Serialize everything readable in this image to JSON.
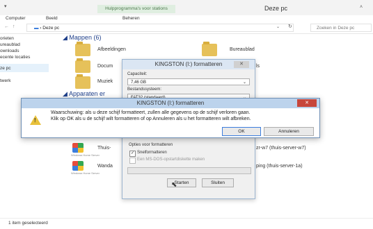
{
  "ribbon": {
    "qat": "▾",
    "tools_tab": "Hulpprogramma's voor stations",
    "window_title": "Deze pc",
    "tabs": [
      "Computer",
      "Beeld",
      "Beheren"
    ]
  },
  "address": {
    "path": "Deze pc",
    "search_placeholder": "Zoeken in Deze pc"
  },
  "nav": {
    "items": [
      "orieten",
      "ureaublad",
      "ownloads",
      "ecente locaties",
      "ze pc",
      "twerk"
    ]
  },
  "content": {
    "group_folders": "Mappen (6)",
    "folders": [
      "Afbeeldingen",
      "Bureaublad",
      "Docum",
      "Muziek"
    ],
    "group_devices": "Apparaten er",
    "network_items": [
      "Thuis-",
      "Wanda"
    ],
    "right_items": [
      "zr-w7 (thuis-server-w7)",
      "ping (thuis-server-1a)"
    ],
    "right_partial": "ls",
    "logo_sub": "Windows Home Server"
  },
  "format_dialog": {
    "title": "KINGSTON (I:) formatteren",
    "capacity_label": "Capaciteit:",
    "capacity_value": "7,46 GB",
    "fs_label": "Bestandssysteem:",
    "fs_value": "FAT32 (standaard)",
    "options_label": "Opties voor formatteren",
    "quick_format": "Snelformatteren",
    "msdos_disk": "Een MS-DOS-opstartdiskette maken",
    "start_button": "Starten",
    "close_button": "Sluiten"
  },
  "warning_dialog": {
    "title": "KINGSTON (I:) formatteren",
    "line1": "Waarschuwing: als u deze schijf formatteert, zullen alle gegevens op de schijf verloren gaan.",
    "line2": "Klik op OK als u de schijf wilt formatteren of op Annuleren als u het formatteren wilt afbreken.",
    "ok": "OK",
    "cancel": "Annuleren"
  },
  "status": {
    "text": "1 item geselecteerd"
  },
  "colors": {
    "accent": "#1e3f8a",
    "tools_tab_bg": "#dfeee0",
    "close_red": "#c7463b"
  }
}
